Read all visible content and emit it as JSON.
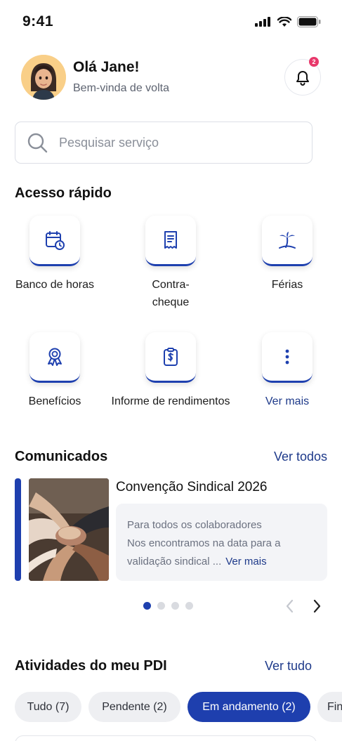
{
  "status_bar": {
    "time": "9:41"
  },
  "header": {
    "greeting": "Olá Jane!",
    "subtitle": "Bem-vinda de volta",
    "notification_count": "2"
  },
  "search": {
    "placeholder": "Pesquisar serviço"
  },
  "quick_access": {
    "title": "Acesso rápido",
    "items": [
      {
        "label": "Banco de horas",
        "icon": "calendar-clock-icon"
      },
      {
        "label": "Contra-\ncheque",
        "icon": "receipt-icon"
      },
      {
        "label": "Férias",
        "icon": "palm-tree-icon"
      },
      {
        "label": "Benefícios",
        "icon": "award-ribbon-icon"
      },
      {
        "label": "Informe de rendimentos",
        "icon": "clipboard-dollar-icon"
      },
      {
        "label": "Ver mais",
        "icon": "more-vertical-icon"
      }
    ]
  },
  "announcements": {
    "title": "Comunicados",
    "see_all": "Ver todos",
    "item": {
      "title": "Convenção Sindical 2026",
      "line1": "Para todos os colaboradores",
      "line2": "Nos encontramos na data para a",
      "line3": "validação sindical ...",
      "more": "Ver mais"
    },
    "carousel": {
      "pages": 4,
      "active": 0
    }
  },
  "activities": {
    "title": "Atividades do meu PDI",
    "see_all": "Ver tudo",
    "filters": [
      {
        "label": "Tudo (7)",
        "active": false
      },
      {
        "label": "Pendente (2)",
        "active": false
      },
      {
        "label": "Em andamento (2)",
        "active": true
      },
      {
        "label": "Fin",
        "active": false
      }
    ]
  },
  "colors": {
    "primary": "#1e3fae",
    "link": "#1e3a8a",
    "badge": "#e8386b"
  }
}
